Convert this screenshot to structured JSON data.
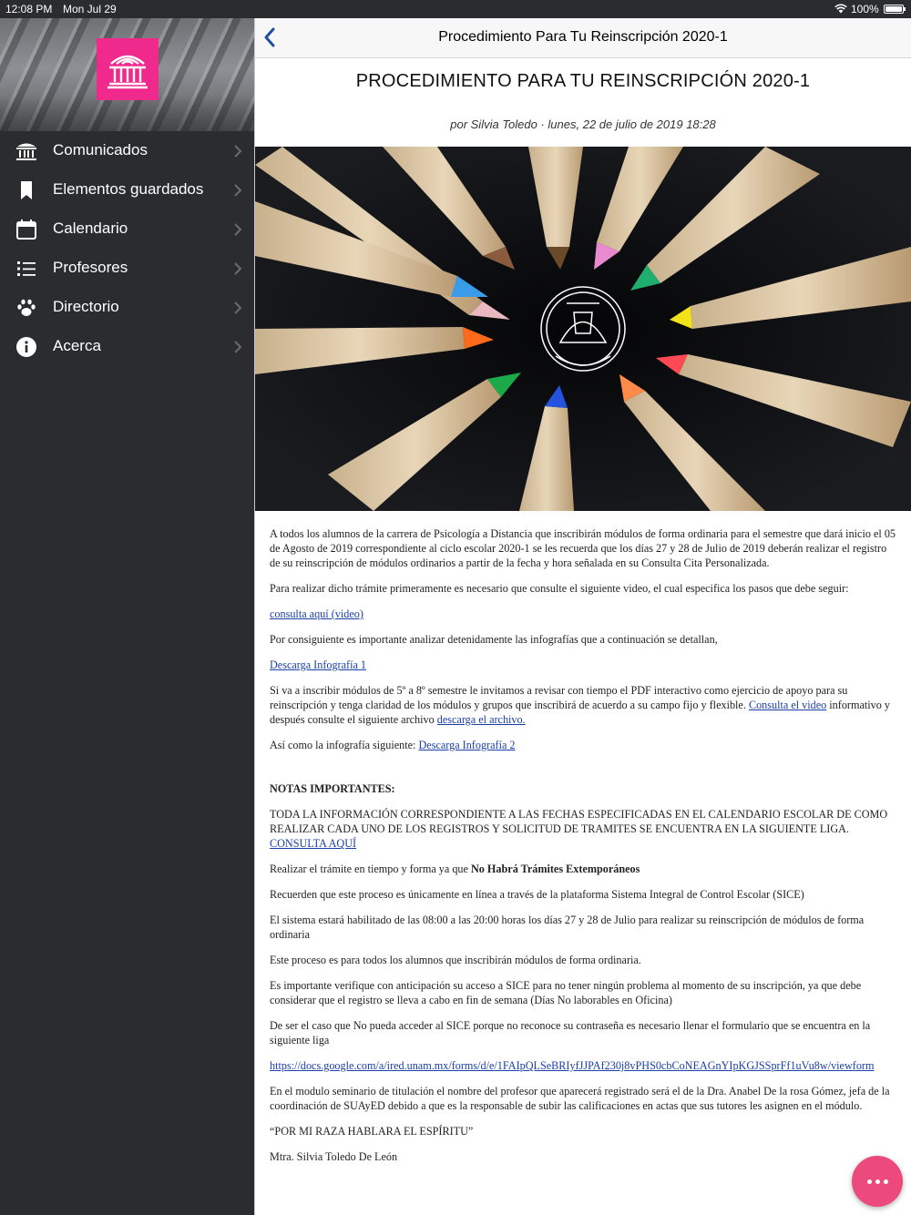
{
  "status_bar": {
    "time": "12:08 PM",
    "date": "Mon Jul 29",
    "battery": "100%"
  },
  "sidebar": {
    "items": [
      {
        "label": "Comunicados",
        "icon": "building-icon"
      },
      {
        "label": "Elementos guardados",
        "icon": "bookmark-icon"
      },
      {
        "label": "Calendario",
        "icon": "calendar-icon"
      },
      {
        "label": "Profesores",
        "icon": "list-icon"
      },
      {
        "label": "Directorio",
        "icon": "paw-icon"
      },
      {
        "label": "Acerca",
        "icon": "info-icon"
      }
    ]
  },
  "navbar": {
    "title": "Procedimiento Para Tu Reinscripción 2020-1"
  },
  "article": {
    "title": "PROCEDIMIENTO PARA TU REINSCRIPCIÓN 2020-1",
    "byline": "por Silvia Toledo · lunes, 22 de julio de 2019 18:28",
    "p1": "A todos los alumnos de la carrera de Psicología a Distancia que inscribirán módulos de forma ordinaria para el semestre que dará inicio el  05 de Agosto de 2019 correspondiente al ciclo escolar 2020-1 se  les recuerda que  los días 27 y 28 de Julio de 2019   deberán realizar el registro de su reinscripción de módulos ordinarios a partir de la fecha y hora señalada en su Consulta Cita Personalizada.",
    "p2": "Para realizar dicho trámite primeramente es necesario que consulte el siguiente video, el cual especifica los pasos que debe seguir:",
    "link_video": "consulta aquí (video)",
    "p3": "Por consiguiente es importante analizar detenidamente las infografías que a continuación se detallan,",
    "link_info1": "Descarga Infografía 1",
    "p4a": "Si va a inscribir módulos de 5º a 8º semestre le invitamos a revisar con tiempo el PDF interactivo como ejercicio de apoyo para su reinscripción y tenga claridad de los módulos y grupos que inscribirá de acuerdo a su campo fijo y flexible. ",
    "link_video2": "Consulta el video",
    "p4b": " informativo y después consulte el siguiente archivo ",
    "link_archivo": "descarga el archivo.",
    "p5a": "Así como la infografía siguiente:  ",
    "link_info2": "Descarga Infografía 2",
    "notes_heading": "NOTAS IMPORTANTES:",
    "p6a": "TODA LA INFORMACIÓN CORRESPONDIENTE A LAS FECHAS ESPECIFICADAS EN EL CALENDARIO ESCOLAR DE COMO REALIZAR CADA UNO DE LOS REGISTROS  Y SOLICITUD DE TRAMITES SE ENCUENTRA EN LA SIGUIENTE LIGA.  ",
    "link_consulta": "CONSULTA AQUÍ",
    "p7a": "Realizar el trámite en tiempo y forma ya que ",
    "p7b": "No Habrá Trámites Extemporáneos",
    "p8": "Recuerden que este proceso es únicamente en línea a través de la plataforma Sistema Integral de Control Escolar  (SICE)",
    "p9": "El sistema estará habilitado de las 08:00 a las 20:00 horas los días 27 y 28 de Julio para realizar su reinscripción de módulos de forma ordinaria",
    "p10": "Este proceso es para todos los alumnos que inscribirán módulos de forma ordinaria.",
    "p11": "Es importante verifique con anticipación su acceso a SICE para no tener ningún problema al momento de su inscripción, ya que debe considerar que el registro se lleva a cabo en fin de semana (Días No laborables en Oficina)",
    "p12": "De ser el caso que No pueda acceder al SICE porque no reconoce su contraseña es necesario llenar el formulario que se encuentra en la siguiente liga",
    "link_form": "https://docs.google.com/a/ired.unam.mx/forms/d/e/1FAIpQLSeBRIyfJJPAf230j8vPHS0cbCoNEAGnYIpKGJSSprFf1uVu8w/viewform",
    "p13": "En el modulo seminario de titulación el nombre del profesor que aparecerá registrado será el de la Dra. Anabel De la rosa  Gómez, jefa de la coordinación de SUAyED debido a que es la responsable de subir las calificaciones en actas que sus tutores les asignen en el módulo.",
    "p14": "“POR MI RAZA HABLARA EL ESPÍRITU”",
    "p15": "Mtra. Silvia Toledo De León"
  },
  "colors": {
    "sidebar_bg": "#2b2c30",
    "logo_bg": "#ef2a8c",
    "fab_bg": "#ec4a7d",
    "link": "#1a3fa8",
    "nav_accent": "#1d4f9c"
  }
}
